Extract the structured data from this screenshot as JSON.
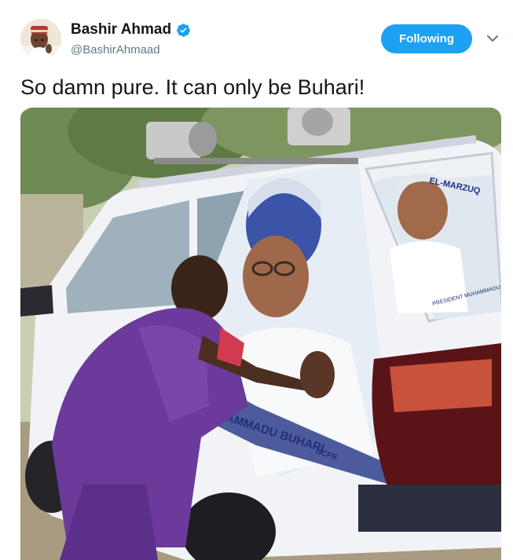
{
  "tweet": {
    "author": {
      "display_name": "Bashir Ahmad",
      "handle": "@BashirAhmaad",
      "verified": true
    },
    "follow_button_label": "Following",
    "more_menu_icon": "chevron-down-icon",
    "text": "So damn pure. It can only be Buhari!",
    "media": {
      "poster_text_side": "MUHAMMADU BUHARI",
      "poster_text_side_suffix": "GCFR",
      "poster_text_rear_top": "EL-MARZUQ",
      "poster_text_rear_caption": "PRESIDENT MUHAMMADU"
    }
  },
  "colors": {
    "accent": "#1da1f2",
    "text_primary": "#14171a",
    "text_secondary": "#657786"
  }
}
